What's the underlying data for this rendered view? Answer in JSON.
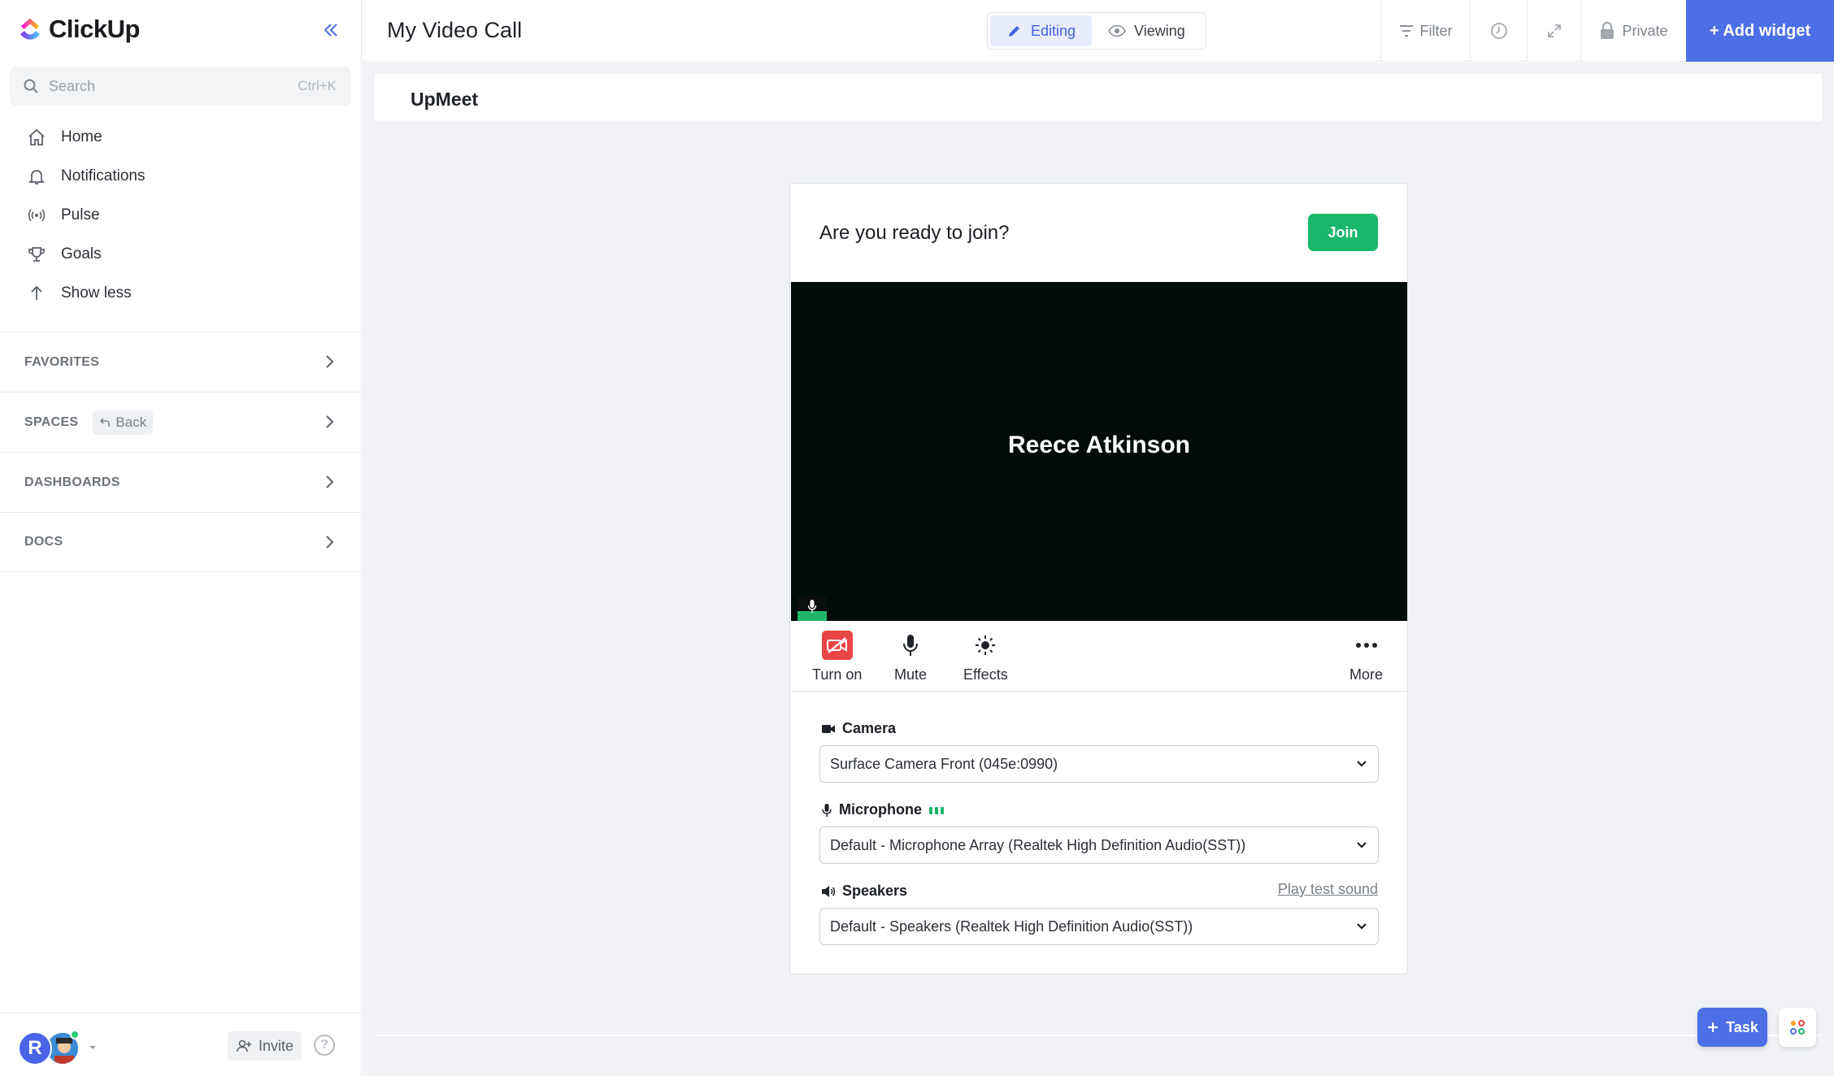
{
  "app": {
    "name": "ClickUp"
  },
  "sidebar": {
    "search_placeholder": "Search",
    "search_shortcut": "Ctrl+K",
    "nav": [
      {
        "label": "Home",
        "icon": "home-icon"
      },
      {
        "label": "Notifications",
        "icon": "bell-icon"
      },
      {
        "label": "Pulse",
        "icon": "pulse-icon"
      },
      {
        "label": "Goals",
        "icon": "trophy-icon"
      },
      {
        "label": "Show less",
        "icon": "arrow-up-icon"
      }
    ],
    "sections": [
      {
        "label": "FAVORITES"
      },
      {
        "label": "SPACES",
        "chip": "Back"
      },
      {
        "label": "DASHBOARDS"
      },
      {
        "label": "DOCS"
      }
    ],
    "footer": {
      "avatar_initial": "R",
      "invite_label": "Invite",
      "help_label": "?"
    }
  },
  "topbar": {
    "title": "My Video Call",
    "mode_editing": "Editing",
    "mode_viewing": "Viewing",
    "filter_label": "Filter",
    "private_label": "Private",
    "add_widget_label": "+ Add widget"
  },
  "widget": {
    "title": "UpMeet"
  },
  "call": {
    "question": "Are you ready to join?",
    "join_label": "Join",
    "participant_name": "Reece Atkinson",
    "controls": {
      "camera": "Turn on",
      "mute": "Mute",
      "effects": "Effects",
      "more": "More"
    },
    "devices": {
      "camera_label": "Camera",
      "camera_value": "Surface Camera Front (045e:0990)",
      "microphone_label": "Microphone",
      "microphone_value": "Default - Microphone Array (Realtek High Definition Audio(SST))",
      "speakers_label": "Speakers",
      "speakers_value": "Default - Speakers (Realtek High Definition Audio(SST))",
      "play_test_label": "Play test sound"
    }
  },
  "floating": {
    "task_label": "Task"
  },
  "colors": {
    "brand_blue": "#4c6fe6",
    "join_green": "#18b86a",
    "camera_off_red": "#e84545",
    "video_bg": "#020d09"
  }
}
